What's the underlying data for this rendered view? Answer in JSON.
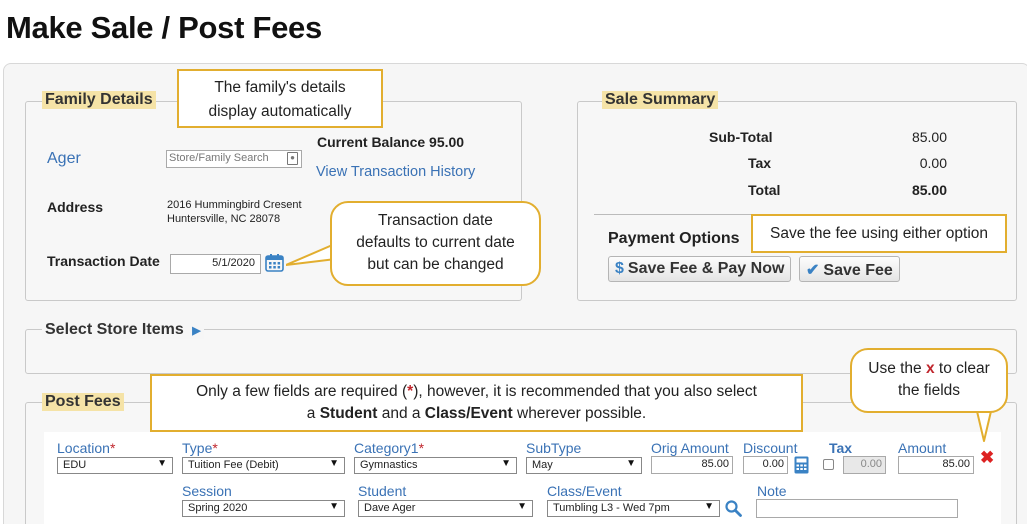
{
  "page": {
    "title": "Make Sale / Post Fees"
  },
  "family": {
    "legend": "Family Details",
    "name": "Ager",
    "search_placeholder": "Store/Family Search",
    "current_balance_label": "Current Balance",
    "current_balance_value": "95.00",
    "history_link": "View Transaction History",
    "address_label": "Address",
    "address_line1": "2016 Hummingbird Cresent",
    "address_line2": "Huntersville, NC 28078",
    "transaction_date_label": "Transaction Date",
    "transaction_date_value": "5/1/2020"
  },
  "summary": {
    "legend": "Sale Summary",
    "subtotal_label": "Sub-Total",
    "subtotal_value": "85.00",
    "tax_label": "Tax",
    "tax_value": "0.00",
    "total_label": "Total",
    "total_value": "85.00",
    "payment_options_label": "Payment Options",
    "save_pay_label": "Save Fee & Pay Now",
    "save_fee_label": "Save Fee"
  },
  "store": {
    "legend": "Select Store Items"
  },
  "fees": {
    "legend": "Post Fees",
    "location_label": "Location",
    "location_value": "EDU",
    "type_label": "Type",
    "type_value": "Tuition Fee (Debit)",
    "category_label": "Category1",
    "category_value": "Gymnastics",
    "subtype_label": "SubType",
    "subtype_value": "May",
    "orig_amount_label": "Orig Amount",
    "orig_amount_value": "85.00",
    "discount_label": "Discount",
    "discount_value": "0.00",
    "tax_label": "Tax",
    "tax_value": "0.00",
    "amount_label": "Amount",
    "amount_value": "85.00",
    "session_label": "Session",
    "session_value": "Spring 2020",
    "student_label": "Student",
    "student_value": "Dave Ager",
    "class_label": "Class/Event",
    "class_value": "Tumbling L3 - Wed 7pm",
    "note_label": "Note",
    "note_value": "",
    "required_mark": "*"
  },
  "callouts": {
    "family_line1": "The family's details",
    "family_line2": "display automatically",
    "date_line1": "Transaction date",
    "date_line2": "defaults to current date",
    "date_line3": "but can be changed",
    "save": "Save the fee using either option",
    "required_pre": "Only a few fields are required (",
    "required_star": "*",
    "required_post": "), however, it is recommended that you also select",
    "required_line2_a": "a ",
    "required_student": "Student",
    "required_line2_b": " and a ",
    "required_class": "Class/Event",
    "required_line2_c": " wherever possible.",
    "clear_pre": "Use the ",
    "clear_x": "x",
    "clear_post": " to clear",
    "clear_line2": "the fields"
  },
  "colors": {
    "accent": "#3a72b5",
    "callout_border": "#e2ae2f",
    "legend_highlight": "#f5e3a7",
    "required": "#c0262d"
  }
}
